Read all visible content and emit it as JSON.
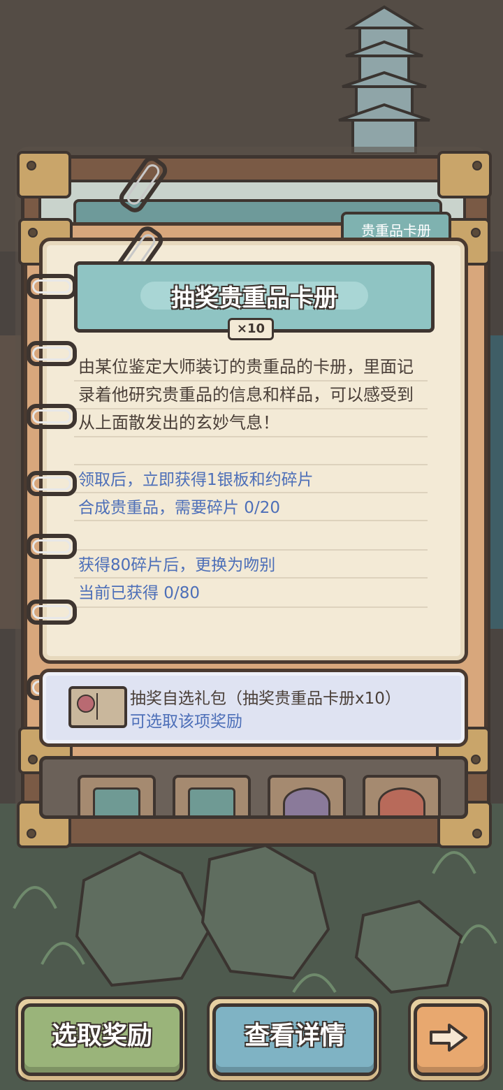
{
  "tab": {
    "label": "贵重品卡册"
  },
  "item": {
    "title": "抽奖贵重品卡册",
    "quantity": "×10",
    "description": "由某位鉴定大师装订的贵重品的卡册，里面记录着他研究贵重品的信息和样品，可以感受到从上面散发出的玄妙气息！",
    "info_line_1": "领取后，立即获得1银板和约碎片",
    "info_line_2": "合成贵重品，需要碎片  0/20",
    "info_line_3": "获得80碎片后，更换为吻别",
    "info_line_4": "当前已获得  0/80"
  },
  "reward": {
    "title": "抽奖自选礼包（抽奖贵重品卡册x10）",
    "subtitle": "可选取该项奖励"
  },
  "buttons": {
    "select": "选取奖励",
    "detail": "查看详情",
    "next_icon": "arrow-right-icon"
  },
  "colors": {
    "title_banner": "#8fc4c3",
    "page": "#f3ead6",
    "info_text": "#4d6fb8",
    "select_button": "#9ab47a",
    "detail_button": "#7fb3c4",
    "next_button": "#e8a86f"
  }
}
